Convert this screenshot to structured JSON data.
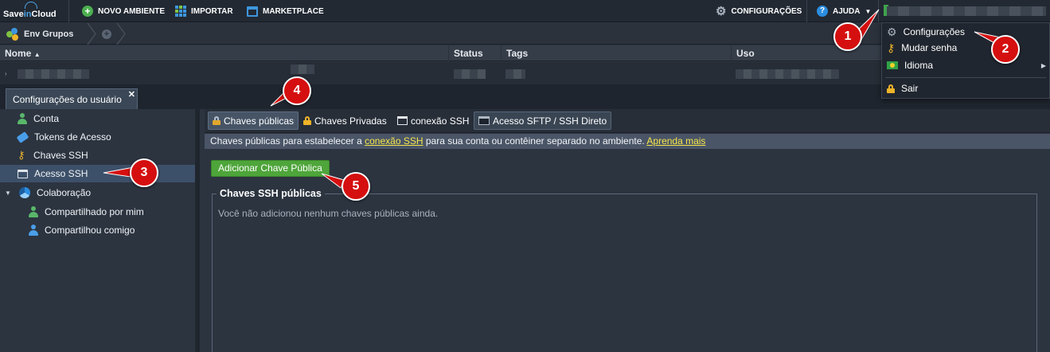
{
  "topbar": {
    "logo_pre": "Save",
    "logo_mid": "in",
    "logo_post": "Cloud",
    "new_env_label": "NOVO AMBIENTE",
    "import_label": "IMPORTAR",
    "marketplace_label": "MARKETPLACE",
    "settings_label": "CONFIGURAÇÕES",
    "help_label": "AJUDA"
  },
  "breadcrumb": {
    "group_label": "Env Grupos"
  },
  "grid": {
    "columns": [
      "Nome",
      "Status",
      "Tags",
      "Uso"
    ],
    "sort_indicator": "▲"
  },
  "tab": {
    "title": "Configurações do usuário",
    "close": "✕"
  },
  "sidebar": {
    "items": [
      {
        "label": "Conta",
        "icon": "user-icon"
      },
      {
        "label": "Tokens de Acesso",
        "icon": "token-icon"
      },
      {
        "label": "Chaves SSH",
        "icon": "key-icon"
      },
      {
        "label": "Acesso SSH",
        "icon": "terminal-icon",
        "selected": true
      },
      {
        "label": "Colaboração",
        "icon": "collaboration-icon"
      },
      {
        "label": "Compartilhado por mim",
        "icon": "shared-icon"
      },
      {
        "label": "Compartilhou comigo",
        "icon": "user-icon"
      }
    ]
  },
  "subtabs": [
    {
      "label": "Chaves públicas",
      "active": true
    },
    {
      "label": "Chaves Privadas"
    },
    {
      "label": "conexão SSH"
    },
    {
      "label": "Acesso SFTP / SSH Direto"
    }
  ],
  "info": {
    "prefix": "Chaves públicas para estabelecer a ",
    "link1": "conexão SSH",
    "middle": " para sua conta ou contêiner separado no ambiente. ",
    "link2": "Aprenda mais"
  },
  "main": {
    "add_button": "Adicionar Chave Pública",
    "section_title": "Chaves SSH públicas",
    "empty_text": "Você não adicionou nenhum chaves públicas ainda."
  },
  "user_menu": {
    "items": [
      {
        "label": "Configurações",
        "icon": "gear-icon"
      },
      {
        "label": "Mudar senha",
        "icon": "key-icon"
      },
      {
        "label": "Idioma",
        "icon": "flag-icon"
      },
      {
        "label": "Sair",
        "icon": "lock-icon"
      }
    ]
  },
  "callouts": [
    "1",
    "2",
    "3",
    "4",
    "5"
  ],
  "colors": {
    "accent_green": "#4ea53a",
    "callout_red": "#d50f0f",
    "selection": "#3d5069",
    "link_yellow": "#f5e64a"
  }
}
